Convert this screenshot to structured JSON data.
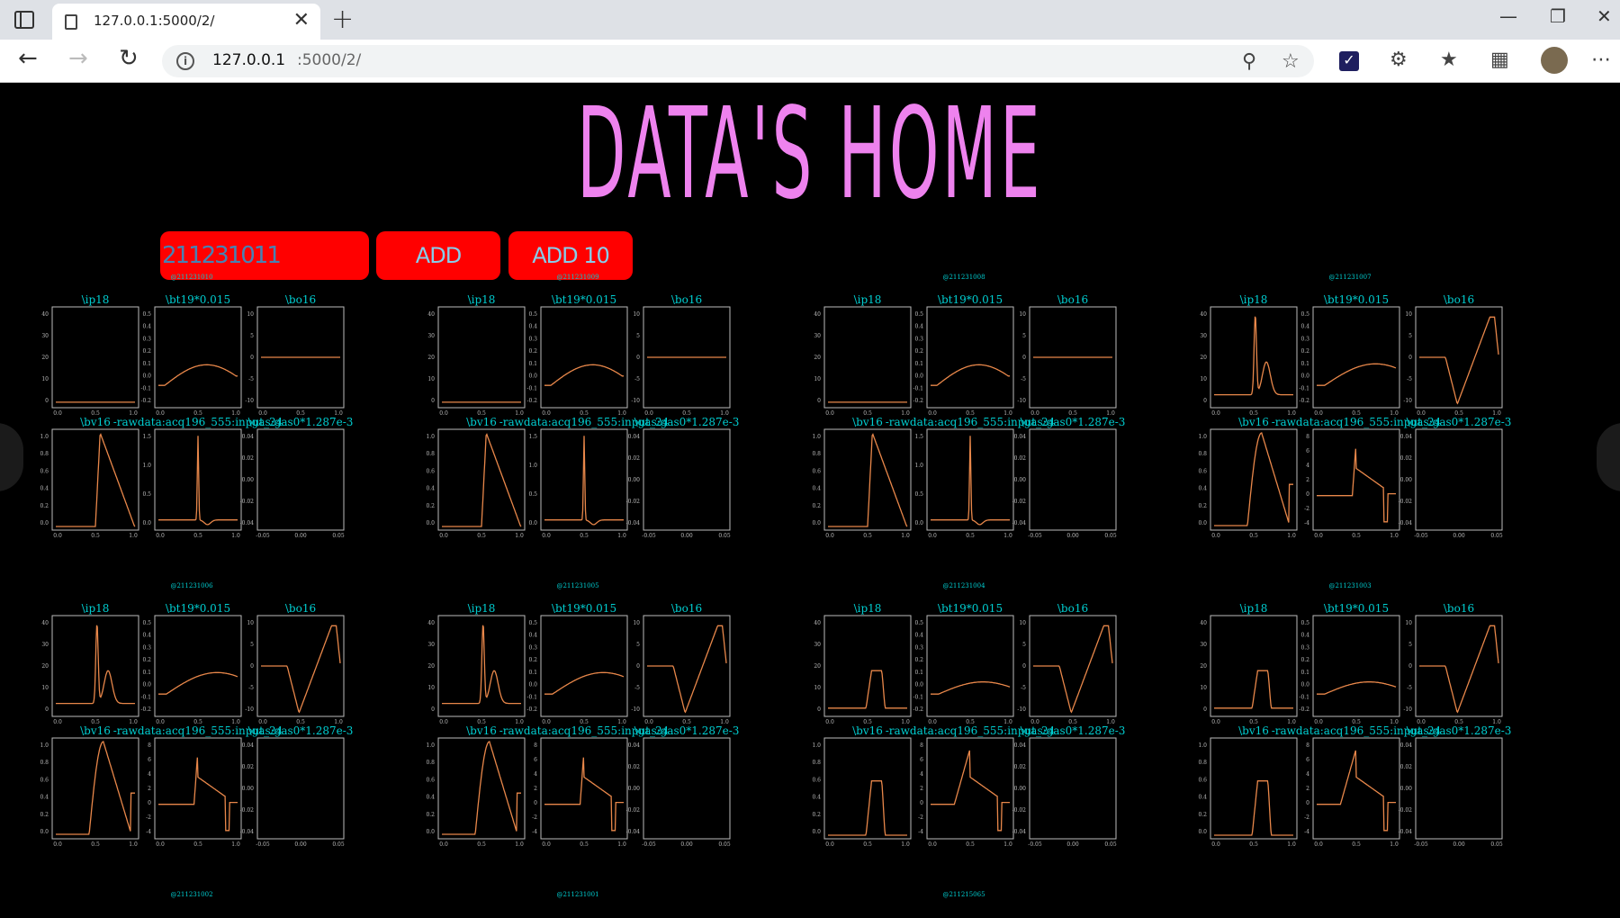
{
  "browser": {
    "tab_title": "127.0.0.1:5000/2/",
    "tab_close": "✕",
    "new_tab": "+",
    "url_host": "127.0.0.1",
    "url_path": ":5000/2/",
    "icons": [
      "sidebar-icon",
      "page-icon",
      "back-icon",
      "forward-icon",
      "reload-icon",
      "info-icon",
      "zoom-icon",
      "favorite-icon",
      "extension-icon",
      "favorites-icon",
      "collections-icon",
      "profile-icon",
      "more-icon"
    ]
  },
  "page": {
    "title": "DATA'S HOME",
    "shot_input_value": "211231011",
    "add_label": "ADD",
    "add10_label": "ADD 10"
  },
  "colors": {
    "title": "#ee82ee",
    "button_bg": "#ff0000",
    "input_text": "#4682b4",
    "button_text": "#87ceeb",
    "plot_label": "#00ced1",
    "plot_line": "#e8874a"
  },
  "chart_data": {
    "type": "line",
    "panel_titles": [
      "\\ip18",
      "\\bt19*0.015",
      "\\bo16",
      "\\bv16",
      "-rawdata:acq196_555:input_24",
      "\\gas:gas0*1.287e-3"
    ],
    "shots": [
      {
        "label": "@211231010",
        "variant": "flat"
      },
      {
        "label": "@211231009",
        "variant": "flat"
      },
      {
        "label": "@211231008",
        "variant": "flat"
      },
      {
        "label": "@211231007",
        "variant": "active"
      },
      {
        "label": "@211231006",
        "variant": "active"
      },
      {
        "label": "@211231005",
        "variant": "active"
      },
      {
        "label": "@211231004",
        "variant": "plateau"
      },
      {
        "label": "@211231003",
        "variant": "plateau"
      },
      {
        "label": "@211231002",
        "variant": "none"
      },
      {
        "label": "@211231001",
        "variant": "none"
      },
      {
        "label": "@211215065",
        "variant": "none"
      }
    ],
    "axes": {
      "time_ticks": [
        "0.0",
        "0.5",
        "1.0"
      ],
      "gas_x_ticks": [
        "-0.05",
        "0.00",
        "0.05"
      ],
      "ip_y_ticks": [
        "0",
        "10",
        "20",
        "30",
        "40"
      ],
      "bt_y_ticks": [
        "-0.2",
        "-0.1",
        "0.0",
        "0.1",
        "0.2",
        "0.3",
        "0.4",
        "0.5"
      ],
      "bo_y_ticks": [
        "-10",
        "-5",
        "0",
        "5",
        "10"
      ],
      "bv_y_ticks": [
        "0.0",
        "0.2",
        "0.4",
        "0.6",
        "0.8",
        "1.0"
      ],
      "raw_flat_y_ticks": [
        "0.0",
        "0.5",
        "1.0",
        "1.5"
      ],
      "raw_active_y_ticks": [
        "-4",
        "-2",
        "0",
        "2",
        "4",
        "6",
        "8"
      ],
      "gas_y_ticks": [
        "-0.04",
        "-0.02",
        "0.00",
        "0.02",
        "0.04"
      ]
    }
  }
}
